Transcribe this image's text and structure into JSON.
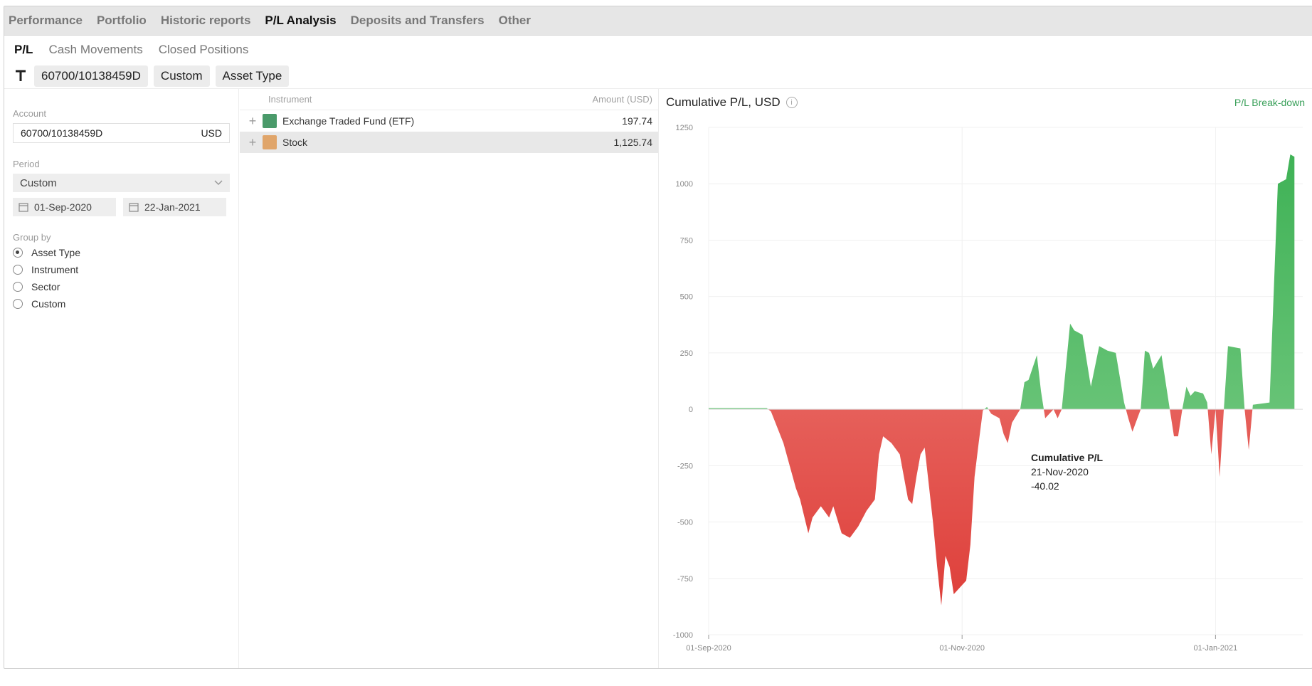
{
  "top_tabs": [
    "Performance",
    "Portfolio",
    "Historic reports",
    "P/L Analysis",
    "Deposits and Transfers",
    "Other"
  ],
  "sub_tabs": [
    "P/L",
    "Cash Movements",
    "Closed Positions"
  ],
  "filters": {
    "account": "60700/10138459D",
    "period": "Custom",
    "group": "Asset Type"
  },
  "left": {
    "account_label": "Account",
    "account_value": "60700/10138459D",
    "account_currency": "USD",
    "period_label": "Period",
    "period_value": "Custom",
    "date_from": "01-Sep-2020",
    "date_to": "22-Jan-2021",
    "group_label": "Group by",
    "group_options": [
      "Asset Type",
      "Instrument",
      "Sector",
      "Custom"
    ],
    "group_selected": "Asset Type"
  },
  "table": {
    "col_instrument": "Instrument",
    "col_amount": "Amount (USD)",
    "rows": [
      {
        "name": "Exchange Traded Fund (ETF)",
        "amount": "197.74",
        "color": "#4a9a6a"
      },
      {
        "name": "Stock",
        "amount": "1,125.74",
        "color": "#e0a56a"
      }
    ]
  },
  "chart_header": {
    "title": "Cumulative P/L, USD",
    "breakdown": "P/L Break-down"
  },
  "tooltip": {
    "title": "Cumulative P/L",
    "date": "21-Nov-2020",
    "value": "-40.02"
  },
  "colors": {
    "positive": "#4cb85c",
    "negative": "#e8605a",
    "accent_green": "#3aa05a"
  },
  "chart_data": {
    "type": "area",
    "title": "Cumulative P/L, USD",
    "ylabel": "",
    "xlabel": "",
    "ylim": [
      -1000,
      1250
    ],
    "yticks": [
      "1250",
      "1000",
      "750",
      "500",
      "250",
      "0",
      "-250",
      "-500",
      "-750",
      "-1000"
    ],
    "xticks": [
      {
        "label": "01-Sep-2020",
        "date": "2020-09-01"
      },
      {
        "label": "01-Nov-2020",
        "date": "2020-11-01"
      },
      {
        "label": "01-Jan-2021",
        "date": "2021-01-01"
      }
    ],
    "grid": true,
    "series": [
      {
        "points": [
          [
            "2020-09-01",
            5
          ],
          [
            "2020-09-15",
            5
          ],
          [
            "2020-09-16",
            -10
          ],
          [
            "2020-09-19",
            -150
          ],
          [
            "2020-09-22",
            -350
          ],
          [
            "2020-09-23",
            -400
          ],
          [
            "2020-09-25",
            -550
          ],
          [
            "2020-09-26",
            -480
          ],
          [
            "2020-09-28",
            -430
          ],
          [
            "2020-09-30",
            -480
          ],
          [
            "2020-10-01",
            -430
          ],
          [
            "2020-10-03",
            -550
          ],
          [
            "2020-10-05",
            -570
          ],
          [
            "2020-10-07",
            -520
          ],
          [
            "2020-10-09",
            -450
          ],
          [
            "2020-10-11",
            -400
          ],
          [
            "2020-10-12",
            -200
          ],
          [
            "2020-10-13",
            -120
          ],
          [
            "2020-10-15",
            -150
          ],
          [
            "2020-10-17",
            -200
          ],
          [
            "2020-10-19",
            -400
          ],
          [
            "2020-10-20",
            -420
          ],
          [
            "2020-10-21",
            -300
          ],
          [
            "2020-10-22",
            -200
          ],
          [
            "2020-10-23",
            -170
          ],
          [
            "2020-10-25",
            -500
          ],
          [
            "2020-10-26",
            -700
          ],
          [
            "2020-10-27",
            -870
          ],
          [
            "2020-10-28",
            -650
          ],
          [
            "2020-10-29",
            -700
          ],
          [
            "2020-10-30",
            -820
          ],
          [
            "2020-11-02",
            -760
          ],
          [
            "2020-11-03",
            -600
          ],
          [
            "2020-11-04",
            -300
          ],
          [
            "2020-11-05",
            -150
          ],
          [
            "2020-11-06",
            -5
          ],
          [
            "2020-11-07",
            10
          ],
          [
            "2020-11-08",
            -20
          ],
          [
            "2020-11-10",
            -40
          ],
          [
            "2020-11-11",
            -110
          ],
          [
            "2020-11-12",
            -150
          ],
          [
            "2020-11-13",
            -60
          ],
          [
            "2020-11-14",
            -30
          ],
          [
            "2020-11-15",
            0
          ],
          [
            "2020-11-16",
            120
          ],
          [
            "2020-11-17",
            130
          ],
          [
            "2020-11-19",
            240
          ],
          [
            "2020-11-20",
            80
          ],
          [
            "2020-11-21",
            -40
          ],
          [
            "2020-11-23",
            0
          ],
          [
            "2020-11-24",
            -40
          ],
          [
            "2020-11-25",
            0
          ],
          [
            "2020-11-27",
            380
          ],
          [
            "2020-11-28",
            350
          ],
          [
            "2020-11-30",
            330
          ],
          [
            "2020-12-02",
            100
          ],
          [
            "2020-12-04",
            280
          ],
          [
            "2020-12-06",
            260
          ],
          [
            "2020-12-08",
            250
          ],
          [
            "2020-12-10",
            30
          ],
          [
            "2020-12-11",
            -40
          ],
          [
            "2020-12-12",
            -100
          ],
          [
            "2020-12-14",
            0
          ],
          [
            "2020-12-15",
            260
          ],
          [
            "2020-12-16",
            250
          ],
          [
            "2020-12-17",
            180
          ],
          [
            "2020-12-19",
            240
          ],
          [
            "2020-12-21",
            0
          ],
          [
            "2020-12-22",
            -120
          ],
          [
            "2020-12-23",
            -120
          ],
          [
            "2020-12-24",
            0
          ],
          [
            "2020-12-25",
            100
          ],
          [
            "2020-12-26",
            60
          ],
          [
            "2020-12-27",
            80
          ],
          [
            "2020-12-29",
            70
          ],
          [
            "2020-12-30",
            30
          ],
          [
            "2020-12-31",
            -200
          ],
          [
            "2021-01-01",
            0
          ],
          [
            "2021-01-02",
            -300
          ],
          [
            "2021-01-03",
            0
          ],
          [
            "2021-01-04",
            280
          ],
          [
            "2021-01-07",
            270
          ],
          [
            "2021-01-08",
            0
          ],
          [
            "2021-01-09",
            -180
          ],
          [
            "2021-01-10",
            20
          ],
          [
            "2021-01-14",
            30
          ],
          [
            "2021-01-16",
            1000
          ],
          [
            "2021-01-18",
            1020
          ],
          [
            "2021-01-19",
            1130
          ],
          [
            "2021-01-20",
            1120
          ]
        ]
      }
    ]
  }
}
